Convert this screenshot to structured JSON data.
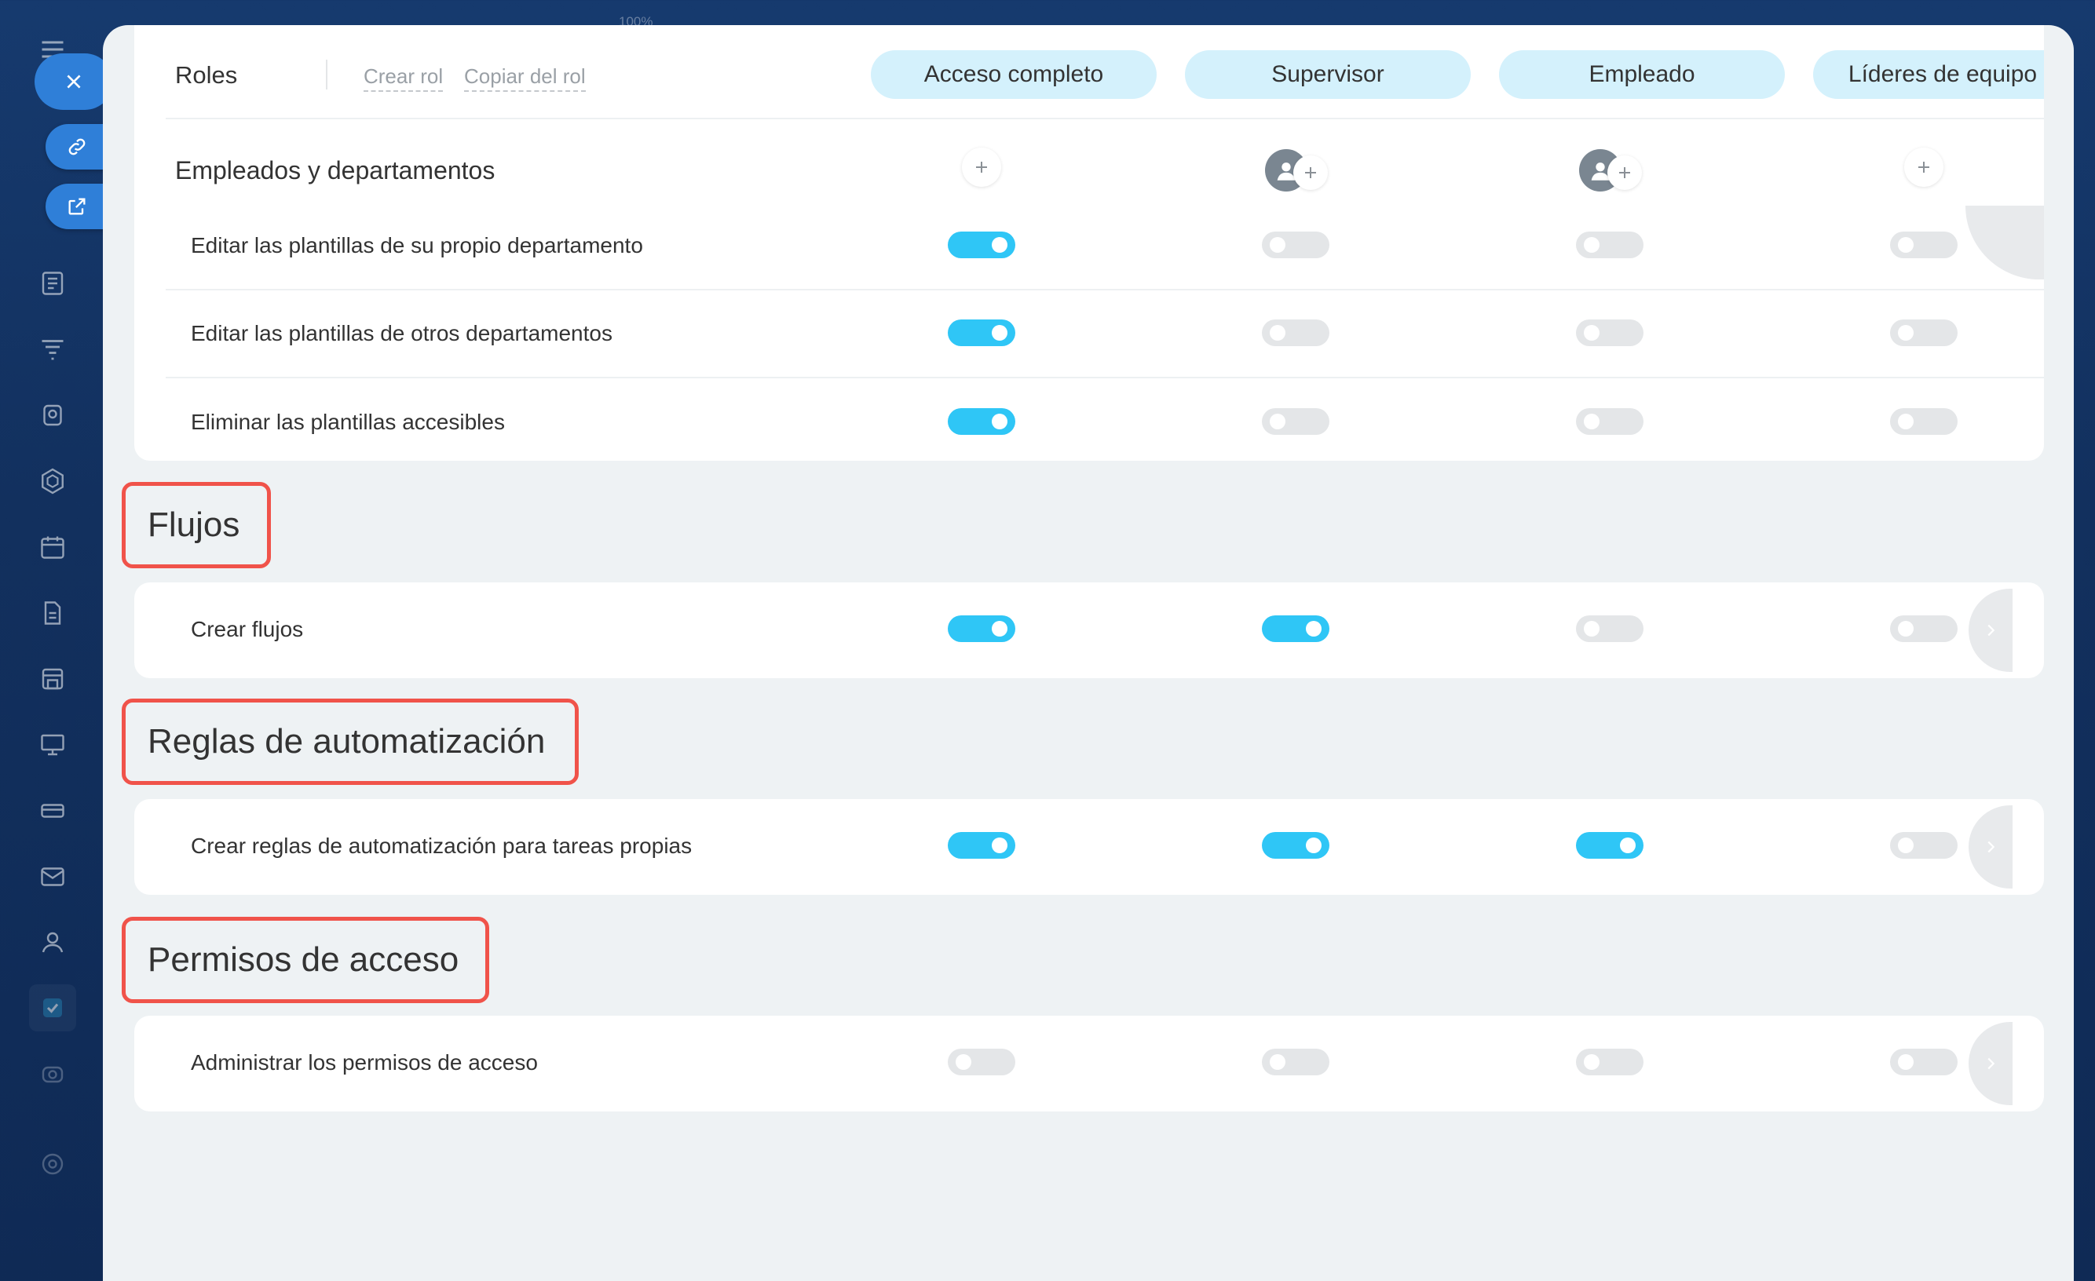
{
  "window": {
    "zoom_label": "100%"
  },
  "header": {
    "title": "Roles",
    "create_role": "Crear rol",
    "copy_role": "Copiar del rol",
    "roles": [
      "Acceso completo",
      "Supervisor",
      "Empleado",
      "Líderes de equipo"
    ]
  },
  "group_employees": {
    "title": "Empleados y departamentos",
    "rows": [
      {
        "label": "Editar las plantillas de su propio departamento",
        "values": [
          true,
          false,
          false,
          false
        ]
      },
      {
        "label": "Editar las plantillas de otros departamentos",
        "values": [
          true,
          false,
          false,
          false
        ]
      },
      {
        "label": "Eliminar las plantillas accesibles",
        "values": [
          true,
          false,
          false,
          false
        ]
      }
    ]
  },
  "sections": [
    {
      "title": "Flujos",
      "rows": [
        {
          "label": "Crear flujos",
          "values": [
            true,
            true,
            false,
            false
          ]
        }
      ]
    },
    {
      "title": "Reglas de automatización",
      "rows": [
        {
          "label": "Crear reglas de automatización para tareas propias",
          "values": [
            true,
            true,
            true,
            false
          ]
        }
      ]
    },
    {
      "title": "Permisos de acceso",
      "rows": [
        {
          "label": "Administrar los permisos de acceso",
          "values": [
            false,
            false,
            false,
            false
          ]
        }
      ]
    }
  ],
  "icons": {
    "rail": [
      "menu-icon",
      "close-icon",
      "link-icon",
      "external-link-icon",
      "news-icon",
      "funnel-icon",
      "robot-icon",
      "hexagon-icon",
      "calendar-icon",
      "document-icon",
      "store-icon",
      "presentation-icon",
      "ticket-icon",
      "mail-icon",
      "users-icon",
      "tasks-icon",
      "team-icon",
      "settings-icon"
    ]
  },
  "colors": {
    "accent": "#2fc6f6",
    "pill": "#d4f1fc",
    "highlight": "#f0534a",
    "rail_button": "#2f7fd8"
  }
}
